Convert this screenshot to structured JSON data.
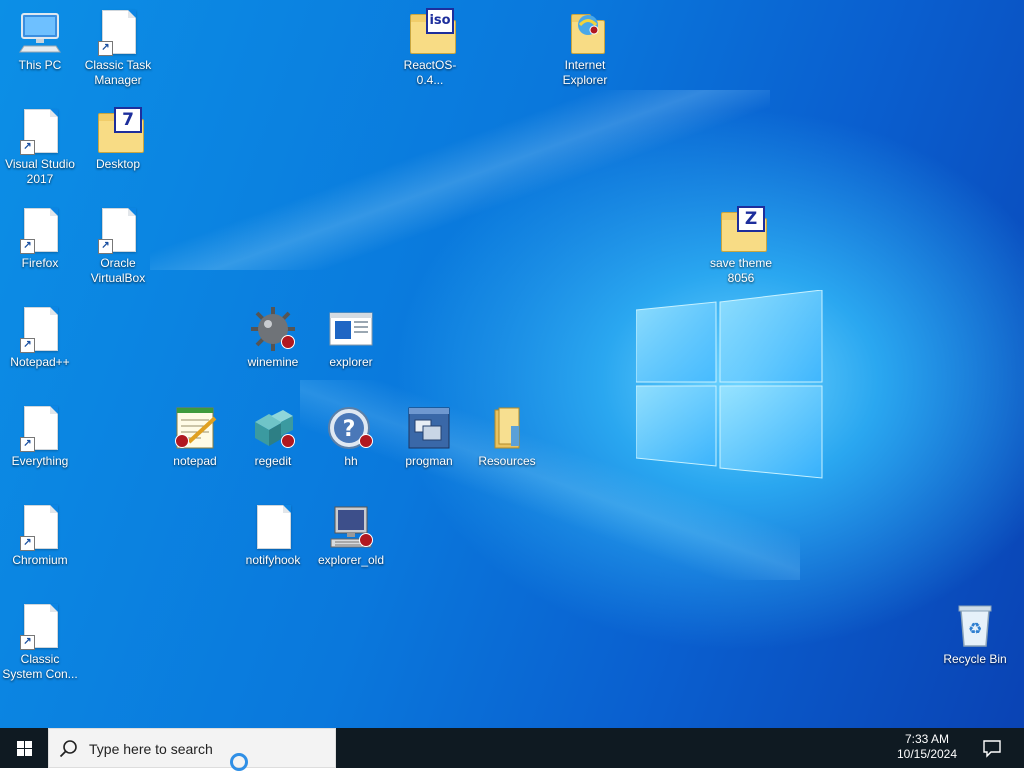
{
  "desktop": {
    "icons": [
      {
        "label": "This PC",
        "icon": "computer-icon"
      },
      {
        "label": "Classic Task\nManager",
        "icon": "document-shortcut-icon"
      },
      {
        "label": "ReactOS-0.4...",
        "icon": "iso-folder-icon",
        "badge": "iso"
      },
      {
        "label": "Internet\nExplorer",
        "icon": "internet-explorer-folder-icon"
      },
      {
        "label": "Visual Studio\n2017",
        "icon": "document-shortcut-icon"
      },
      {
        "label": "Desktop",
        "icon": "7zip-folder-icon",
        "badge": "7"
      },
      {
        "label": "Firefox",
        "icon": "document-shortcut-icon"
      },
      {
        "label": "Oracle\nVirtualBox",
        "icon": "document-shortcut-icon"
      },
      {
        "label": "save theme\n8056",
        "icon": "zip-folder-icon",
        "badge": "Z"
      },
      {
        "label": "Notepad++",
        "icon": "document-shortcut-icon"
      },
      {
        "label": "winemine",
        "icon": "mine-icon"
      },
      {
        "label": "explorer",
        "icon": "explorer-window-icon"
      },
      {
        "label": "Everything",
        "icon": "document-shortcut-icon"
      },
      {
        "label": "notepad",
        "icon": "notepad-icon"
      },
      {
        "label": "regedit",
        "icon": "registry-icon"
      },
      {
        "label": "hh",
        "icon": "help-icon"
      },
      {
        "label": "progman",
        "icon": "program-manager-icon"
      },
      {
        "label": "Resources",
        "icon": "folder-icon"
      },
      {
        "label": "Chromium",
        "icon": "document-shortcut-icon"
      },
      {
        "label": "notifyhook",
        "icon": "document-icon"
      },
      {
        "label": "explorer_old",
        "icon": "monitor-icon"
      },
      {
        "label": "Classic\nSystem Con...",
        "icon": "document-shortcut-icon"
      },
      {
        "label": "Recycle Bin",
        "icon": "recycle-bin-icon"
      }
    ]
  },
  "taskbar": {
    "search_placeholder": "Type here to search",
    "time": "7:33 AM",
    "date": "10/15/2024"
  },
  "colors": {
    "taskbar": "#0f1a22",
    "desktop_blue": "#0a78dc",
    "badge_blue": "#1d2e9c"
  }
}
